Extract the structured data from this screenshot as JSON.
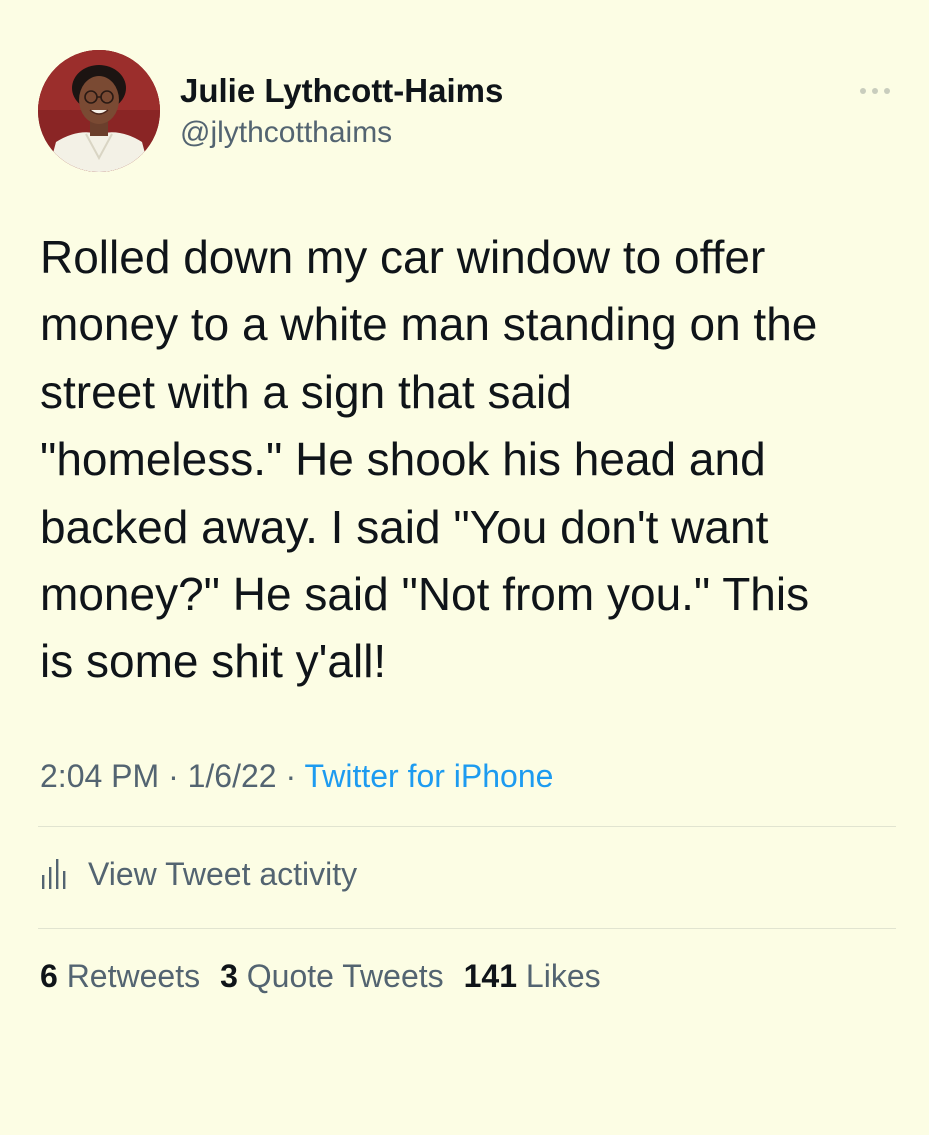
{
  "author": {
    "display_name": "Julie Lythcott-Haims",
    "handle": "@jlythcotthaims"
  },
  "tweet": {
    "text": "Rolled down my car window to offer\nmoney to a white man standing on the\nstreet with a sign that said\n\"homeless.\" He shook his head and\nbacked away. I said \"You don't want\nmoney?\" He said \"Not from you.\" This\nis some shit y'all!",
    "time": "2:04 PM",
    "date": "1/6/22",
    "separator": "·",
    "source": "Twitter for iPhone"
  },
  "activity": {
    "label": "View Tweet activity"
  },
  "stats": {
    "retweets_count": "6",
    "retweets_label": "Retweets",
    "quotes_count": "3",
    "quotes_label": "Quote Tweets",
    "likes_count": "141",
    "likes_label": "Likes"
  },
  "colors": {
    "background": "#fcfde4",
    "text": "#0f1419",
    "secondary": "#536471",
    "link": "#1d9bf0"
  },
  "icons": {
    "more": "more-horizontal-icon",
    "activity": "bar-chart-icon"
  }
}
